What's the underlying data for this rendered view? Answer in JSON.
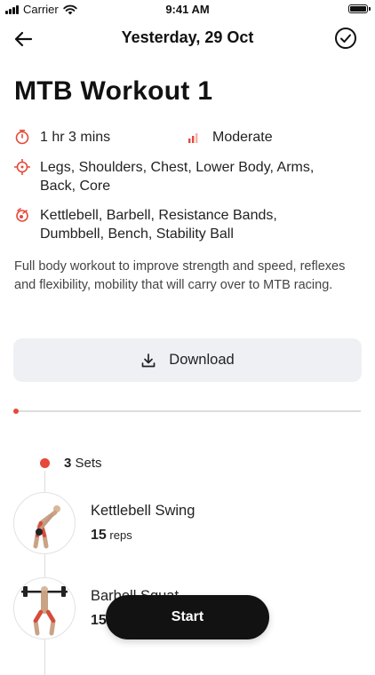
{
  "status_bar": {
    "carrier": "Carrier",
    "time": "9:41 AM"
  },
  "nav": {
    "title": "Yesterday, 29 Oct",
    "back_icon": "back-arrow-icon",
    "done_icon": "check-circle-icon"
  },
  "workout": {
    "title": "MTB Workout 1",
    "duration": "1 hr 3 mins",
    "intensity": "Moderate",
    "body_parts": "Legs, Shoulders, Chest, Lower Body, Arms, Back, Core",
    "equipment": "Kettlebell, Barbell, Resistance Bands, Dumbbell, Bench, Stability Ball",
    "description": "Full body workout to improve strength and speed, reflexes and flexibility, mobility that will carry over to MTB racing."
  },
  "download_label": "Download",
  "progress": 0.0,
  "sets": {
    "count": "3",
    "label": "Sets"
  },
  "exercises": [
    {
      "name": "Kettlebell Swing",
      "reps": "15",
      "unit": "reps"
    },
    {
      "name": "Barbell Squat",
      "reps": "15",
      "unit": "reps"
    }
  ],
  "start_label": "Start",
  "colors": {
    "accent": "#e5493a",
    "button_dark": "#121212",
    "download_bg": "#eef0f4"
  }
}
